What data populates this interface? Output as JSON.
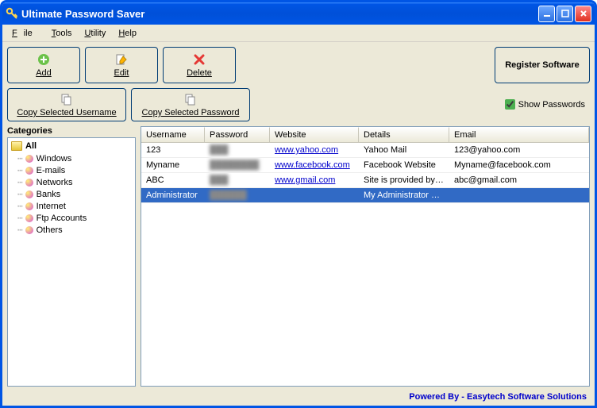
{
  "window": {
    "title": "Ultimate Password Saver"
  },
  "menu": {
    "file": "File",
    "tools": "Tools",
    "utility": "Utility",
    "help": "Help"
  },
  "toolbar": {
    "add": "Add",
    "edit": "Edit",
    "delete": "Delete",
    "copy_user": "Copy Selected Username",
    "copy_pw": "Copy Selected Password",
    "register": "Register Software",
    "show_pw": "Show Passwords",
    "show_pw_checked": true
  },
  "sidebar": {
    "title": "Categories",
    "root": "All",
    "items": [
      "Windows",
      "E-mails",
      "Networks",
      "Banks",
      "Internet",
      "Ftp Accounts",
      "Others"
    ]
  },
  "table": {
    "columns": [
      "Username",
      "Password",
      "Website",
      "Details",
      "Email"
    ],
    "rows": [
      {
        "username": "123",
        "password": "███",
        "website": "www.yahoo.com",
        "details": "Yahoo Mail",
        "email": "123@yahoo.com",
        "selected": false
      },
      {
        "username": "Myname",
        "password": "████████",
        "website": "www.facebook.com",
        "details": "Facebook Website",
        "email": "Myname@facebook.com",
        "selected": false
      },
      {
        "username": "ABC",
        "password": "███",
        "website": "www.gmail.com",
        "details": "Site is provided by g…",
        "email": "abc@gmail.com",
        "selected": false
      },
      {
        "username": "Administrator",
        "password": "██████",
        "website": "",
        "details": "My Administrator User",
        "email": "",
        "selected": true
      }
    ]
  },
  "footer": {
    "text": "Powered By - Easytech Software Solutions"
  }
}
